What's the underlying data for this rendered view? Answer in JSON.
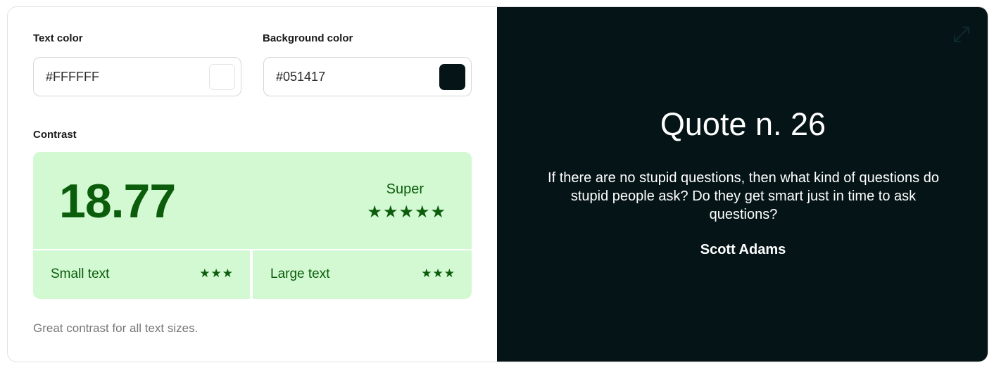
{
  "text_color": {
    "label": "Text color",
    "value": "#FFFFFF",
    "swatch": "#FFFFFF"
  },
  "background_color": {
    "label": "Background color",
    "value": "#051417",
    "swatch": "#051417"
  },
  "contrast": {
    "label": "Contrast",
    "ratio": "18.77",
    "rating": "Super",
    "stars": "★★★★★",
    "star_count": 5,
    "small_text": {
      "label": "Small text",
      "stars": "★★★",
      "star_count": 3
    },
    "large_text": {
      "label": "Large text",
      "stars": "★★★",
      "star_count": 3
    },
    "colors": {
      "panel_bg": "#d2f9d2",
      "text": "#0b5d0b"
    }
  },
  "note": "Great contrast for all text sizes.",
  "preview": {
    "title": "Quote n. 26",
    "text": "If there are no stupid questions, then what kind of questions do stupid people ask? Do they get smart just in time to ask questions?",
    "author": "Scott Adams",
    "icon": "expand-icon"
  }
}
